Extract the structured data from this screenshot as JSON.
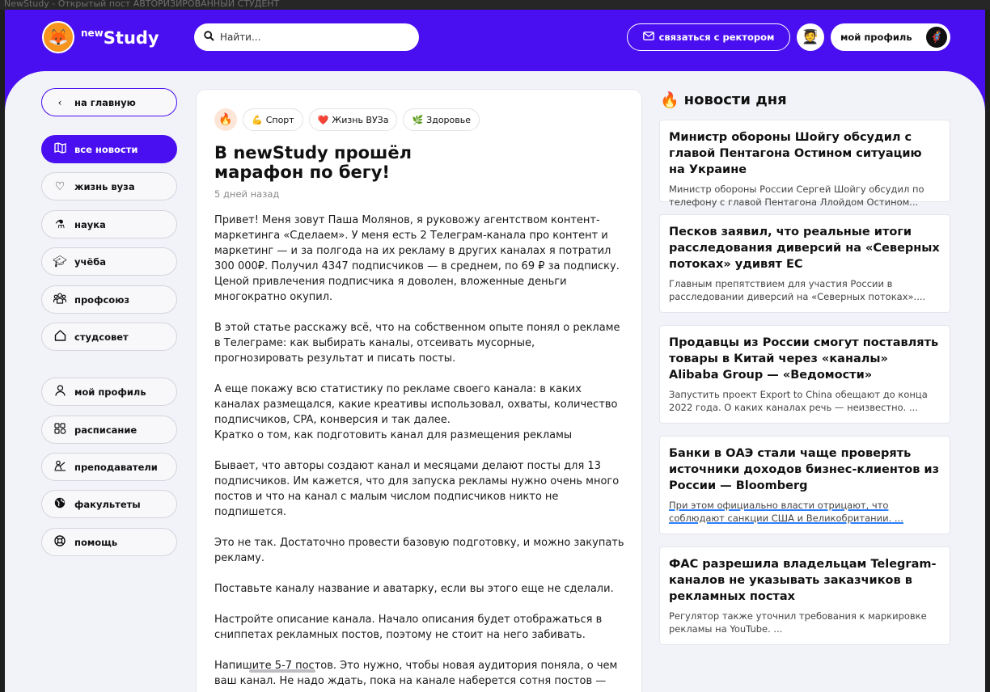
{
  "window": {
    "title": "NewStudy - Открытый пост  АВТОРИЗИРОВАННЫЙ СТУДЕНТ"
  },
  "header": {
    "logo": {
      "sup": "new",
      "main": "Study"
    },
    "search": {
      "placeholder": "Найти..."
    },
    "contact_label": "связаться с ректором",
    "profile_label": "мой профиль"
  },
  "sidebar": {
    "back": "на главную",
    "nav": [
      {
        "label": "все новости",
        "icon": "map-icon",
        "active": true
      },
      {
        "label": "жизнь вуза",
        "icon": "heart-icon"
      },
      {
        "label": "наука",
        "icon": "flask-icon"
      },
      {
        "label": "учёба",
        "icon": "graduation-cap-icon"
      },
      {
        "label": "профсоюз",
        "icon": "people-icon"
      },
      {
        "label": "студсовет",
        "icon": "home-icon"
      }
    ],
    "secondary": [
      {
        "label": "мой профиль",
        "icon": "user-icon"
      },
      {
        "label": "расписание",
        "icon": "schedule-icon"
      },
      {
        "label": "преподаватели",
        "icon": "teacher-icon"
      },
      {
        "label": "факультеты",
        "icon": "globe-icon"
      },
      {
        "label": "помощь",
        "icon": "lifebuoy-icon"
      }
    ]
  },
  "article": {
    "tags": [
      {
        "emoji": "💪",
        "label": "Спорт"
      },
      {
        "emoji": "❤️",
        "label": "Жизнь ВУЗа"
      },
      {
        "emoji": "🌿",
        "label": "Здоровье"
      }
    ],
    "title": "В newStudy прошёл марафон по бегу!",
    "date": "5 дней назад",
    "paragraphs": [
      "Привет! Меня зовут Паша Молянов, я руковожу агентством контент-маркетинга «Сделаем». У меня есть 2 Телеграм-канала про контент и маркетинг — и за полгода на их рекламу в других каналах я потратил 300 000₽. Получил 4347 подписчиков — в среднем, по 69 ₽ за подписку. Ценой привлечения подписчика я доволен, вложенные деньги многократно окупил.",
      "В этой статье расскажу всё, что на собственном опыте понял о рекламе в Телеграме: как выбирать каналы, отсеивать мусорные, прогнозировать результат и писать посты.",
      "А еще покажу всю статистику по рекламе своего канала: в каких каналах размещался, какие креативы использовал, охваты, количество подписчиков, CPA, конверсия и так далее.",
      "Кратко о том, как подготовить канал для размещения рекламы",
      "Бывает, что авторы создают канал и месяцами делают посты для 13 подписчиков. Им кажется, что для запуска рекламы нужно очень много постов и что на канал с малым числом подписчиков никто не подпишется.",
      "Это не так. Достаточно провести базовую подготовку, и можно закупать рекламу.",
      "Поставьте каналу название и аватарку, если вы этого еще не сделали.",
      "Настройте описание канала. Начало описания будет отображаться в сниппетах рекламных постов, поэтому не стоит на него забивать.",
      "Напишите 5-7 постов. Это нужно, чтобы новая аудитория поняла, о чем ваш канал. Не надо ждать, пока на канале наберется сотня постов —"
    ]
  },
  "news": {
    "title": "новости дня",
    "items": [
      {
        "title": "Министр обороны Шойгу обсудил с главой Пентагона Остином ситуацию на Украине",
        "desc": "Министр обороны России Сергей Шойгу обсудил по телефону с главой Пентагона Ллойдом Остином..."
      },
      {
        "title": "Песков заявил, что реальные итоги расследования диверсий на «Северных потоках» удивят ЕС",
        "desc": "Главным препятствием для участия России в расследовании диверсий на «Северных потоках»...."
      },
      {
        "title": "Продавцы из России смогут поставлять товары в Китай через «каналы» Alibaba Group — «Ведомости»",
        "desc": "Запустить проект Export to China обещают до конца 2022 года. О каких каналах речь — неизвестно. ..."
      },
      {
        "title": "Банки в ОАЭ стали чаще проверять источники доходов бизнес-клиентов из России — Bloomberg",
        "desc": "При этом официально власти отрицают, что соблюдают санкции США и Великобритании. ..."
      },
      {
        "title": "ФАС разрешила владельцам Telegram-каналов не указывать заказчиков в рекламных постах",
        "desc": "Регулятор также уточнил требования к маркировке рекламы на YouTube. ..."
      }
    ]
  },
  "colors": {
    "brand": "#4a0ff0",
    "background": "#f2f3f8",
    "underline": "#2a7fff"
  }
}
